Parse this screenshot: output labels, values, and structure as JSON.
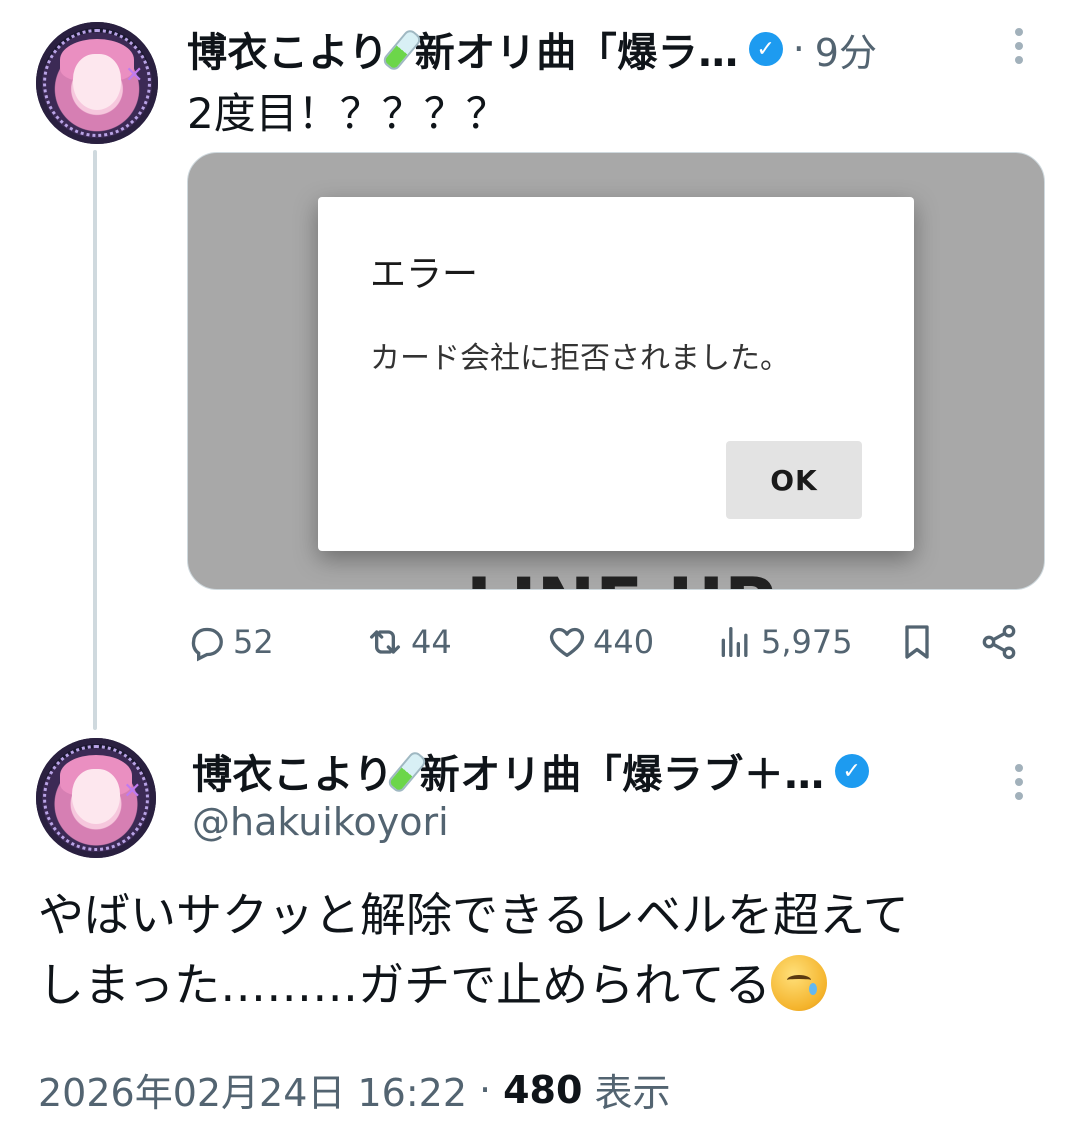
{
  "reply_tweet": {
    "author_name": "博衣こより",
    "name_suffix": "新オリ曲「爆ラ…",
    "time_separator": "·",
    "time": "9分",
    "text": "2度目！？？？？",
    "media": {
      "dialog_title": "エラー",
      "dialog_message": "カード会社に拒否されました。",
      "dialog_button": "OK",
      "background_text": "LINE UP"
    },
    "actions": {
      "replies": "52",
      "reposts": "44",
      "likes": "440",
      "views": "5,975"
    }
  },
  "main_tweet": {
    "author_name": "博衣こより",
    "name_suffix": "新オリ曲「爆ラブ＋…",
    "handle": "@hakuikoyori",
    "text_line1": "やばいサクッと解除できるレベルを超えて",
    "text_line2": "しまった………ガチで止められてる",
    "emoji": "crying-smile-emoji",
    "timestamp": "2026年02月24日 16:22",
    "separator": "·",
    "view_count": "480",
    "view_label": "表示"
  },
  "colors": {
    "verified": "#1d9bf0",
    "muted": "#536471",
    "thread_line": "#cfd9de"
  }
}
